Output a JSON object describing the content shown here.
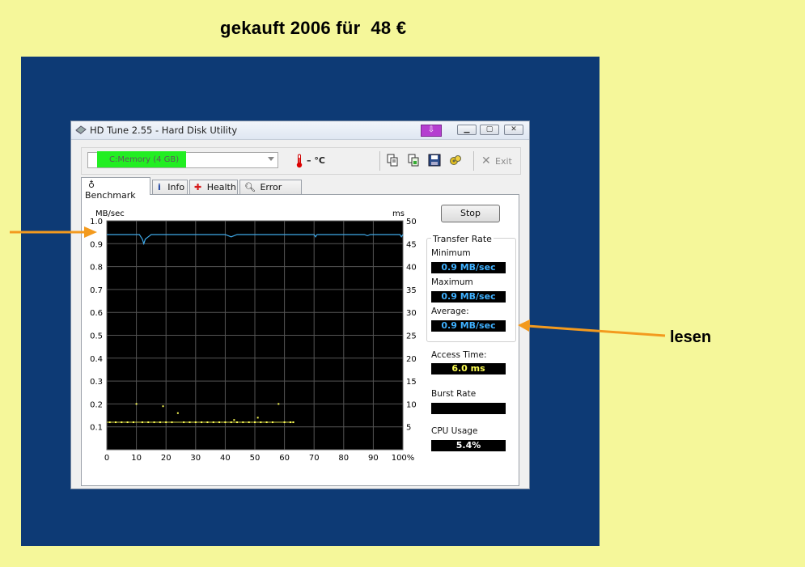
{
  "headline": "gekauft 2006 für  48 €",
  "annotation_label": "lesen",
  "window": {
    "title": "HD Tune 2.55 - Hard Disk Utility",
    "drive": "C:Memory (4 GB)",
    "temperature": "– °C",
    "exit_label": "Exit",
    "tabs": [
      "Benchmark",
      "Info",
      "Health",
      "Error Scan"
    ]
  },
  "benchmark": {
    "stop_label": "Stop",
    "transfer_rate_title": "Transfer Rate",
    "minimum_label": "Minimum",
    "minimum_value": "0.9 MB/sec",
    "maximum_label": "Maximum",
    "maximum_value": "0.9 MB/sec",
    "average_label": "Average:",
    "average_value": "0.9 MB/sec",
    "access_time_label": "Access Time:",
    "access_time_value": "6.0 ms",
    "burst_rate_label": "Burst Rate",
    "burst_rate_value": "",
    "cpu_usage_label": "CPU Usage",
    "cpu_usage_value": "5.4%"
  },
  "colors": {
    "page_bg": "#f5f79a",
    "box_bg": "#0d3a75",
    "arrow": "#f39a1e",
    "transfer_line": "#3fa9e8",
    "access_points": "#ffff55"
  },
  "chart_data": {
    "type": "line",
    "ylabel_left": "MB/sec",
    "ylabel_right": "ms",
    "x_ticks": [
      "0",
      "10",
      "20",
      "30",
      "40",
      "50",
      "60",
      "70",
      "80",
      "90",
      "100%"
    ],
    "y_left_ticks": [
      "1.0",
      "0.9",
      "0.8",
      "0.7",
      "0.6",
      "0.5",
      "0.4",
      "0.3",
      "0.2",
      "0.1"
    ],
    "y_right_ticks": [
      "50",
      "45",
      "40",
      "35",
      "30",
      "25",
      "20",
      "15",
      "10",
      "5"
    ],
    "xlim": [
      0,
      100
    ],
    "ylim_left": [
      0,
      1.0
    ],
    "ylim_right": [
      0,
      50
    ],
    "grid": true,
    "series": [
      {
        "axis": "left",
        "x": [
          0,
          11,
          12,
          12.5,
          13,
          14,
          15,
          40,
          42,
          44,
          70,
          70.5,
          71,
          87,
          88,
          89,
          99,
          99.5,
          100
        ],
        "values": [
          0.94,
          0.94,
          0.92,
          0.9,
          0.92,
          0.93,
          0.94,
          0.94,
          0.93,
          0.94,
          0.94,
          0.93,
          0.94,
          0.94,
          0.935,
          0.94,
          0.94,
          0.93,
          0.94
        ]
      },
      {
        "axis": "right",
        "kind": "points",
        "x": [
          1,
          3,
          5,
          7,
          9,
          10,
          12,
          14,
          16,
          18,
          19,
          20,
          22,
          24,
          26,
          28,
          30,
          32,
          34,
          36,
          38,
          40,
          42,
          43,
          44,
          46,
          48,
          50,
          51,
          52,
          54,
          56,
          58,
          60,
          62,
          63
        ],
        "values": [
          6.0,
          6.0,
          6.0,
          6.0,
          6.0,
          10.0,
          6.0,
          6.0,
          6.0,
          6.0,
          9.5,
          6.0,
          6.0,
          8.0,
          6.0,
          6.0,
          6.0,
          6.0,
          6.0,
          6.0,
          6.0,
          6.0,
          6.0,
          6.5,
          6.0,
          6.0,
          6.0,
          6.0,
          7.0,
          6.0,
          6.0,
          6.0,
          10.0,
          6.0,
          6.0,
          6.0
        ]
      }
    ]
  }
}
